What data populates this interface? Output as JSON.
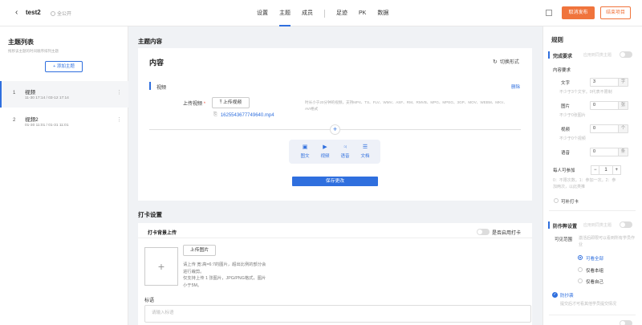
{
  "header": {
    "back_icon": "chevron-left-icon",
    "title": "test2",
    "visibility": "全公开",
    "nav": [
      "设置",
      "主题",
      "成员",
      "足迹",
      "PK",
      "数据"
    ],
    "active_nav": "主题",
    "cancel_publish": "取消发布",
    "end_project": "结束项目",
    "accent": "#2f6fde",
    "warn": "#f0743c"
  },
  "left": {
    "title": "主题列表",
    "subtitle": "拖移该主题的时间顺序排列主题",
    "add_button": "+ 添加主题",
    "topics": [
      {
        "num": "1",
        "name": "视频",
        "time": "11-30 17:14 / 03-12 17:14"
      },
      {
        "num": "2",
        "name": "视频2",
        "time": "01-30 11:01 / 01-31 11:01"
      }
    ]
  },
  "main": {
    "topic_content_label": "主题内容",
    "content_title": "内容",
    "switch_form": "切换形式",
    "block_label": "视频",
    "delete": "删除",
    "upload_label": "上传视频",
    "upload_button": "上传视频",
    "upload_hint": "时长小于20分钟的视频，支持MP4、TS、FLV、WMV、ASF、RM、RMVB、MPG、MPEG、3GP、MOV、WEBM、MKV、AVI格式",
    "file_name": "1625543677749640.mp4",
    "tools": [
      {
        "icon": "image-text-icon",
        "label": "图文"
      },
      {
        "icon": "video-icon",
        "label": "视频"
      },
      {
        "icon": "mic-icon",
        "label": "语音"
      },
      {
        "icon": "document-icon",
        "label": "文档"
      }
    ],
    "save_button": "保存更改",
    "checkin_label": "打卡设置",
    "bg_upload_title": "打卡背景上传",
    "enable_bg": "是否启用打卡",
    "img_upload_button": "上传图片",
    "img_hint_1": "请上传 宽:高=6:7的图片，超出比例的部分会进行裁剪。",
    "img_hint_2": "仅支持上传 1 张图片，JPG/PNG格式，图片小于5M。",
    "tag_label": "标语",
    "tag_placeholder": "请输入标语"
  },
  "right": {
    "title": "规则",
    "complete_req": "完成要求",
    "apply_all": "应用到同类主题",
    "content_req": "内容要求",
    "text_label": "文字",
    "text_value": "3",
    "text_unit": "字",
    "text_hint": "不少于3个文字。0代表不限制",
    "image_label": "图片",
    "image_value": "0",
    "image_unit": "张",
    "image_hint": "不少于0张图片",
    "video_label": "视频",
    "video_value": "0",
    "video_unit": "个",
    "video_hint": "不少于0个视频",
    "voice_label": "语音",
    "voice_value": "0",
    "voice_unit": "条",
    "per_person": "每人可参加",
    "per_person_value": "1",
    "per_person_hint": "0：不限次数。1：参加一次。2：参加两次，以此类推",
    "makeup": "可补打卡",
    "anti_cheat": "防作弊设置",
    "apply_all_2": "应用到同类主题",
    "visible_range": "可见范围",
    "visible_hint": "激活后即限可以看到所有学员作业",
    "options": [
      "可看全部",
      "仅看本组",
      "仅看自己"
    ],
    "anti_copy": "防抄袭",
    "anti_copy_hint": "提交后才可看其他学员提交情况"
  }
}
